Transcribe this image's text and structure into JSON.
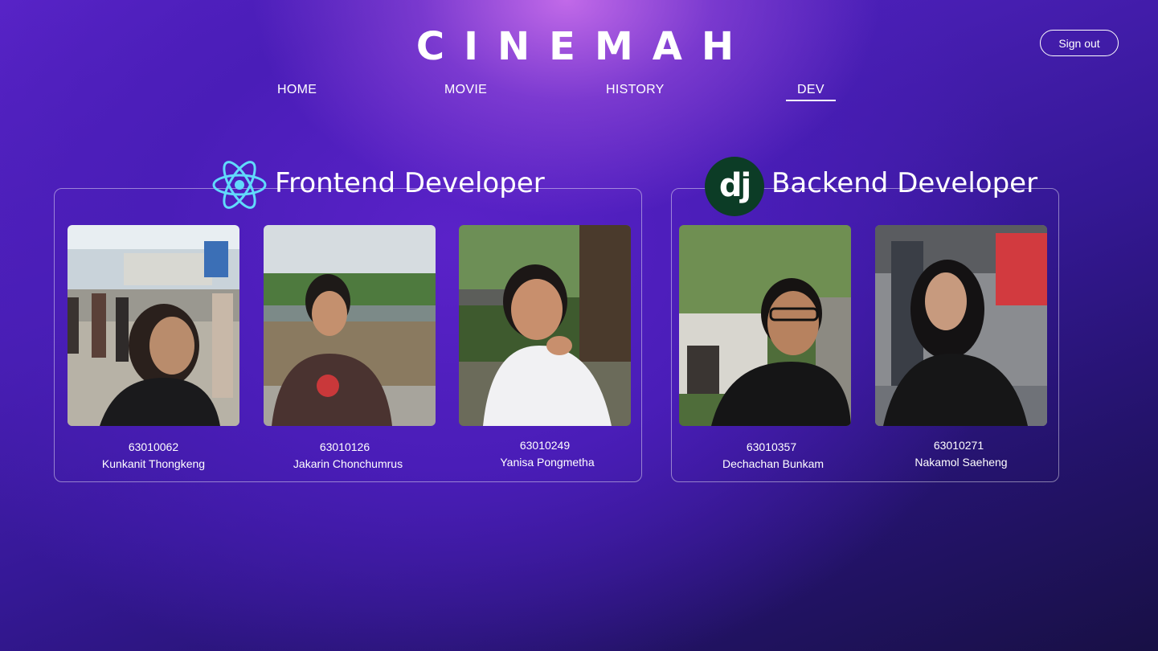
{
  "app": {
    "brand": "CINEMAH",
    "sign_out_label": "Sign out"
  },
  "nav": {
    "items": [
      {
        "label": "HOME",
        "active": false
      },
      {
        "label": "MOVIE",
        "active": false
      },
      {
        "label": "HISTORY",
        "active": false
      },
      {
        "label": "DEV",
        "active": true
      }
    ]
  },
  "frontend": {
    "title": "Frontend Developer",
    "logo_icon": "react-icon",
    "members": [
      {
        "id": "63010062",
        "name": "Kunkanit Thongkeng"
      },
      {
        "id": "63010126",
        "name": "Jakarin Chonchumrus"
      },
      {
        "id": "63010249",
        "name": "Yanisa Pongmetha"
      }
    ]
  },
  "backend": {
    "title": "Backend Developer",
    "logo_icon": "django-icon",
    "logo_text": "dj",
    "members": [
      {
        "id": "63010357",
        "name": "Dechachan Bunkam"
      },
      {
        "id": "63010271",
        "name": "Nakamol Saeheng"
      }
    ]
  },
  "colors": {
    "accent_react": "#61dafb",
    "django_green": "#0c3c26",
    "text": "#ffffff"
  }
}
